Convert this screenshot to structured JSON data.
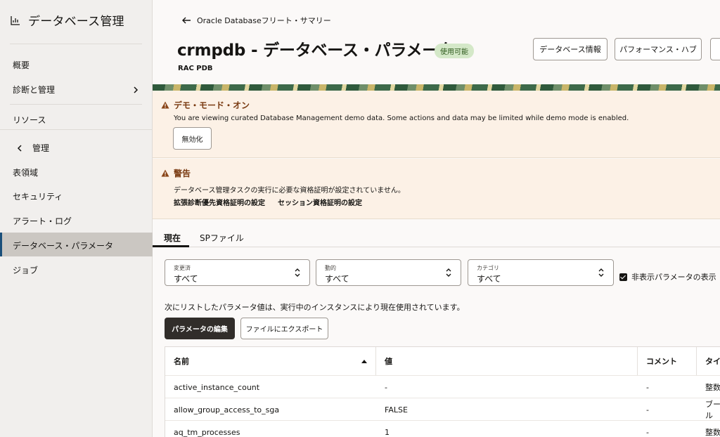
{
  "sidebar": {
    "title": "データベース管理",
    "items": {
      "overview": "概要",
      "diagnostics": "診断と管理",
      "resources": "リソース",
      "manage_back": "管理",
      "tablespaces": "表領域",
      "security": "セキュリティ",
      "alert_log": "アラート・ログ",
      "db_params": "データベース・パラメータ",
      "jobs": "ジョブ"
    }
  },
  "header": {
    "back_link": "Oracle Databaseフリート・サマリー",
    "title": "crmpdb - データベース・パラメータ",
    "status_badge": "使用可能",
    "subtitle": "RAC PDB",
    "buttons": {
      "db_info": "データベース情報",
      "perf_hub": "パフォーマンス・ハブ"
    }
  },
  "demo_alert": {
    "title": "デモ・モード・オン",
    "message": "You are viewing curated Database Management demo data. Some actions and data may be limited while demo mode is enabled.",
    "disable_button": "無効化"
  },
  "warning_alert": {
    "title": "警告",
    "message": "データベース管理タスクの実行に必要な資格証明が設定されていません。",
    "link1": "拡張診断優先資格証明の設定",
    "link2": "セッション資格証明の設定"
  },
  "tabs": {
    "current": "現在",
    "spfile": "SPファイル"
  },
  "filters": {
    "changed": {
      "label": "変更済",
      "value": "すべて"
    },
    "dynamic": {
      "label": "動的",
      "value": "すべて"
    },
    "category": {
      "label": "カテゴリ",
      "value": "すべて"
    },
    "show_hidden": "非表示パラメータの表示"
  },
  "info_text": "次にリストしたパラメータ値は、実行中のインスタンスにより現在使用されています。",
  "actions": {
    "edit": "パラメータの編集",
    "export": "ファイルにエクスポート"
  },
  "table": {
    "columns": {
      "name": "名前",
      "value": "値",
      "comment": "コメント",
      "type": "タイプ"
    },
    "rows": [
      {
        "name": "active_instance_count",
        "value": "-",
        "comment": "-",
        "type": "整数"
      },
      {
        "name": "allow_group_access_to_sga",
        "value": "FALSE",
        "comment": "-",
        "type": "ブール"
      },
      {
        "name": "aq_tm_processes",
        "value": "1",
        "comment": "-",
        "type": "整数"
      }
    ]
  }
}
